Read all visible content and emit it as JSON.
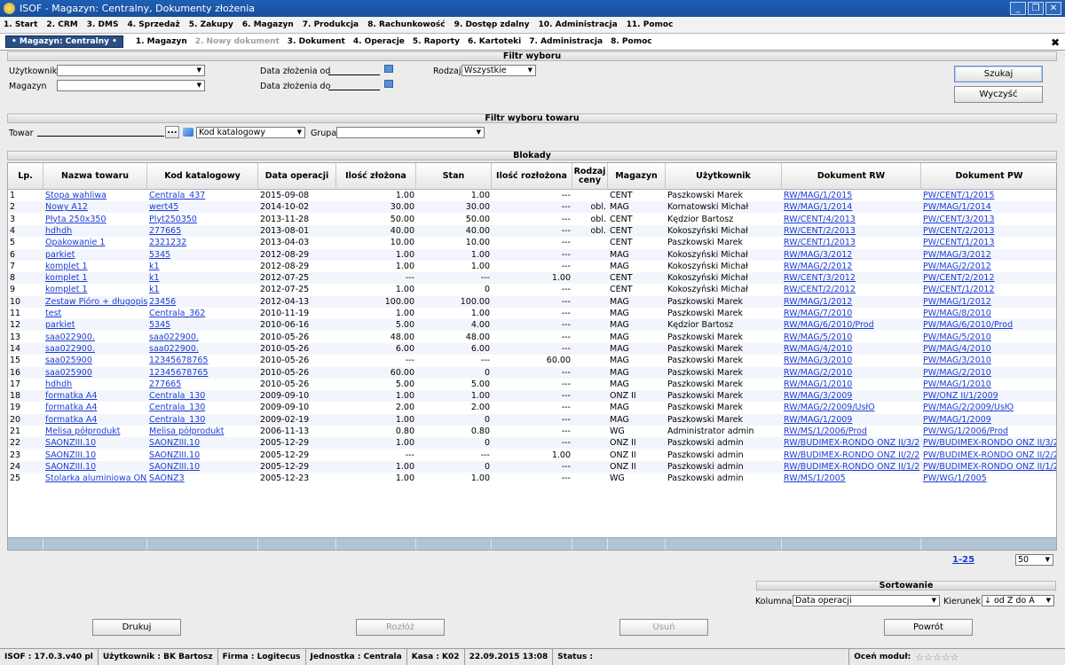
{
  "window": {
    "title": "ISOF - Magazyn: Centralny, Dokumenty złożenia",
    "min": "_",
    "restore": "❐",
    "close": "✕"
  },
  "main_menu": [
    "1. Start",
    "2. CRM",
    "3. DMS",
    "4. Sprzedaż",
    "5. Zakupy",
    "6. Magazyn",
    "7. Produkcja",
    "8. Rachunkowość",
    "9. Dostęp zdalny",
    "10. Administracja",
    "11. Pomoc"
  ],
  "sub_menu": {
    "module": "• Magazyn: Centralny •",
    "items": [
      {
        "label": "1. Magazyn",
        "disabled": false
      },
      {
        "label": "2. Nowy dokument",
        "disabled": true
      },
      {
        "label": "3. Dokument",
        "disabled": false
      },
      {
        "label": "4. Operacje",
        "disabled": false
      },
      {
        "label": "5. Raporty",
        "disabled": false
      },
      {
        "label": "6. Kartoteki",
        "disabled": false
      },
      {
        "label": "7. Administracja",
        "disabled": false
      },
      {
        "label": "8. Pomoc",
        "disabled": false
      }
    ],
    "close": "✖"
  },
  "filter": {
    "title": "Filtr wyboru",
    "user_label": "Użytkownik",
    "user_value": "",
    "warehouse_label": "Magazyn",
    "warehouse_value": "",
    "date_from_label": "Data złożenia od",
    "date_to_label": "Data złożenia do",
    "kind_label": "Rodzaj",
    "kind_value": "Wszystkie",
    "search_btn": "Szukaj",
    "clear_btn": "Wyczyść"
  },
  "product_filter": {
    "title": "Filtr wyboru towaru",
    "item_label": "Towar",
    "item_value": "",
    "browse_btn": "...",
    "code_type": "Kod katalogowy",
    "group_label": "Grupa",
    "group_value": ""
  },
  "grid": {
    "title": "Blokady",
    "columns": [
      "Lp.",
      "Nazwa towaru",
      "Kod katalogowy",
      "Data operacji",
      "Ilość złożona",
      "Stan",
      "Ilość rozłożona",
      "Rodzaj ceny",
      "Magazyn",
      "Użytkownik",
      "Dokument RW",
      "Dokument PW"
    ],
    "rows": [
      [
        "1",
        "Stopa wahliwa",
        "Centrala_437",
        "2015-09-08",
        "1.00",
        "1.00",
        "---",
        "",
        "CENT",
        "Paszkowski Marek",
        "RW/MAG/1/2015",
        "PW/CENT/1/2015"
      ],
      [
        "2",
        "Nowy A12",
        "wert45",
        "2014-10-02",
        "30.00",
        "30.00",
        "---",
        "obl.",
        "MAG",
        "Kornatowski Michał",
        "RW/MAG/1/2014",
        "PW/MAG/1/2014"
      ],
      [
        "3",
        "Płyta 250x350",
        "Plyt250350",
        "2013-11-28",
        "50.00",
        "50.00",
        "---",
        "obl.",
        "CENT",
        "Kędzior Bartosz",
        "RW/CENT/4/2013",
        "PW/CENT/3/2013"
      ],
      [
        "4",
        "hdhdh",
        "277665",
        "2013-08-01",
        "40.00",
        "40.00",
        "---",
        "obl.",
        "CENT",
        "Kokoszyński Michał",
        "RW/CENT/2/2013",
        "PW/CENT/2/2013"
      ],
      [
        "5",
        "Opakowanie 1",
        "2321232",
        "2013-04-03",
        "10.00",
        "10.00",
        "---",
        "",
        "CENT",
        "Paszkowski Marek",
        "RW/CENT/1/2013",
        "PW/CENT/1/2013"
      ],
      [
        "6",
        "parkiet",
        "5345",
        "2012-08-29",
        "1.00",
        "1.00",
        "---",
        "",
        "MAG",
        "Kokoszyński Michał",
        "RW/MAG/3/2012",
        "PW/MAG/3/2012"
      ],
      [
        "7",
        "komplet 1",
        "k1",
        "2012-08-29",
        "1.00",
        "1.00",
        "---",
        "",
        "MAG",
        "Kokoszyński Michał",
        "RW/MAG/2/2012",
        "PW/MAG/2/2012"
      ],
      [
        "8",
        "komplet 1",
        "k1",
        "2012-07-25",
        "---",
        "---",
        "1.00",
        "",
        "CENT",
        "Kokoszyński Michał",
        "RW/CENT/3/2012",
        "PW/CENT/2/2012"
      ],
      [
        "9",
        "komplet 1",
        "k1",
        "2012-07-25",
        "1.00",
        "0",
        "---",
        "",
        "CENT",
        "Kokoszyński Michał",
        "RW/CENT/2/2012",
        "PW/CENT/1/2012"
      ],
      [
        "10",
        "Zestaw Pióro + długopis",
        "23456",
        "2012-04-13",
        "100.00",
        "100.00",
        "---",
        "",
        "MAG",
        "Paszkowski Marek",
        "RW/MAG/1/2012",
        "PW/MAG/1/2012"
      ],
      [
        "11",
        "test",
        "Centrala_362",
        "2010-11-19",
        "1.00",
        "1.00",
        "---",
        "",
        "MAG",
        "Paszkowski Marek",
        "RW/MAG/7/2010",
        "PW/MAG/8/2010"
      ],
      [
        "12",
        "parkiet",
        "5345",
        "2010-06-16",
        "5.00",
        "4.00",
        "---",
        "",
        "MAG",
        "Kędzior Bartosz",
        "RW/MAG/6/2010/Prod",
        "PW/MAG/6/2010/Prod"
      ],
      [
        "13",
        "saa022900.",
        "saa022900.",
        "2010-05-26",
        "48.00",
        "48.00",
        "---",
        "",
        "MAG",
        "Paszkowski Marek",
        "RW/MAG/5/2010",
        "PW/MAG/5/2010"
      ],
      [
        "14",
        "saa022900.",
        "saa022900.",
        "2010-05-26",
        "6.00",
        "6.00",
        "---",
        "",
        "MAG",
        "Paszkowski Marek",
        "RW/MAG/4/2010",
        "PW/MAG/4/2010"
      ],
      [
        "15",
        "saa025900",
        "12345678765",
        "2010-05-26",
        "---",
        "---",
        "60.00",
        "",
        "MAG",
        "Paszkowski Marek",
        "RW/MAG/3/2010",
        "PW/MAG/3/2010"
      ],
      [
        "16",
        "saa025900",
        "12345678765",
        "2010-05-26",
        "60.00",
        "0",
        "---",
        "",
        "MAG",
        "Paszkowski Marek",
        "RW/MAG/2/2010",
        "PW/MAG/2/2010"
      ],
      [
        "17",
        "hdhdh",
        "277665",
        "2010-05-26",
        "5.00",
        "5.00",
        "---",
        "",
        "MAG",
        "Paszkowski Marek",
        "RW/MAG/1/2010",
        "PW/MAG/1/2010"
      ],
      [
        "18",
        "formatka A4",
        "Centrala_130",
        "2009-09-10",
        "1.00",
        "1.00",
        "---",
        "",
        "ONZ II",
        "Paszkowski Marek",
        "RW/MAG/3/2009",
        "PW/ONZ II/1/2009"
      ],
      [
        "19",
        "formatka A4",
        "Centrala_130",
        "2009-09-10",
        "2.00",
        "2.00",
        "---",
        "",
        "MAG",
        "Paszkowski Marek",
        "RW/MAG/2/2009/UsłO",
        "PW/MAG/2/2009/UsłO"
      ],
      [
        "20",
        "formatka A4",
        "Centrala_130",
        "2009-02-19",
        "1.00",
        "0",
        "---",
        "",
        "MAG",
        "Paszkowski Marek",
        "RW/MAG/1/2009",
        "PW/MAG/1/2009"
      ],
      [
        "21",
        "Melisa półprodukt",
        "Melisa półprodukt",
        "2006-11-13",
        "0.80",
        "0.80",
        "---",
        "",
        "WG",
        "Administrator admin",
        "RW/MS/1/2006/Prod",
        "PW/WG/1/2006/Prod"
      ],
      [
        "22",
        "SAONZIII.10",
        "SAONZIII.10",
        "2005-12-29",
        "1.00",
        "0",
        "---",
        "",
        "ONZ II",
        "Paszkowski admin",
        "RW/BUDIMEX-RONDO ONZ II/3/2",
        "PW/BUDIMEX-RONDO ONZ II/3/2"
      ],
      [
        "23",
        "SAONZIII.10",
        "SAONZIII.10",
        "2005-12-29",
        "---",
        "---",
        "1.00",
        "",
        "ONZ II",
        "Paszkowski admin",
        "RW/BUDIMEX-RONDO ONZ II/2/2",
        "PW/BUDIMEX-RONDO ONZ II/2/2"
      ],
      [
        "24",
        "SAONZIII.10",
        "SAONZIII.10",
        "2005-12-29",
        "1.00",
        "0",
        "---",
        "",
        "ONZ II",
        "Paszkowski admin",
        "RW/BUDIMEX-RONDO ONZ II/1/2",
        "PW/BUDIMEX-RONDO ONZ II/1/2"
      ],
      [
        "25",
        "Stolarka aluminiowa ONZ",
        "SAONZ3",
        "2005-12-23",
        "1.00",
        "1.00",
        "---",
        "",
        "WG",
        "Paszkowski admin",
        "RW/MS/1/2005",
        "PW/WG/1/2005"
      ]
    ]
  },
  "pagination": {
    "range": "1-25",
    "page_size": "50"
  },
  "sorting": {
    "title": "Sortowanie",
    "column_label": "Kolumna",
    "column_value": "Data operacji",
    "direction_label": "Kierunek",
    "direction_value": "↓ od Z do A"
  },
  "actions": {
    "print": "Drukuj",
    "split": "Rozłóż",
    "delete": "Usuń",
    "back": "Powrót"
  },
  "status": {
    "version": "ISOF : 17.0.3.v40 pl",
    "user": "Użytkownik : BK Bartosz",
    "company": "Firma : Logitecus",
    "unit": "Jednostka : Centrala",
    "register": "Kasa : K02",
    "datetime": "22.09.2015 13:08",
    "status": "Status :",
    "rate": "Oceń moduł:",
    "stars": "☆☆☆☆☆"
  }
}
